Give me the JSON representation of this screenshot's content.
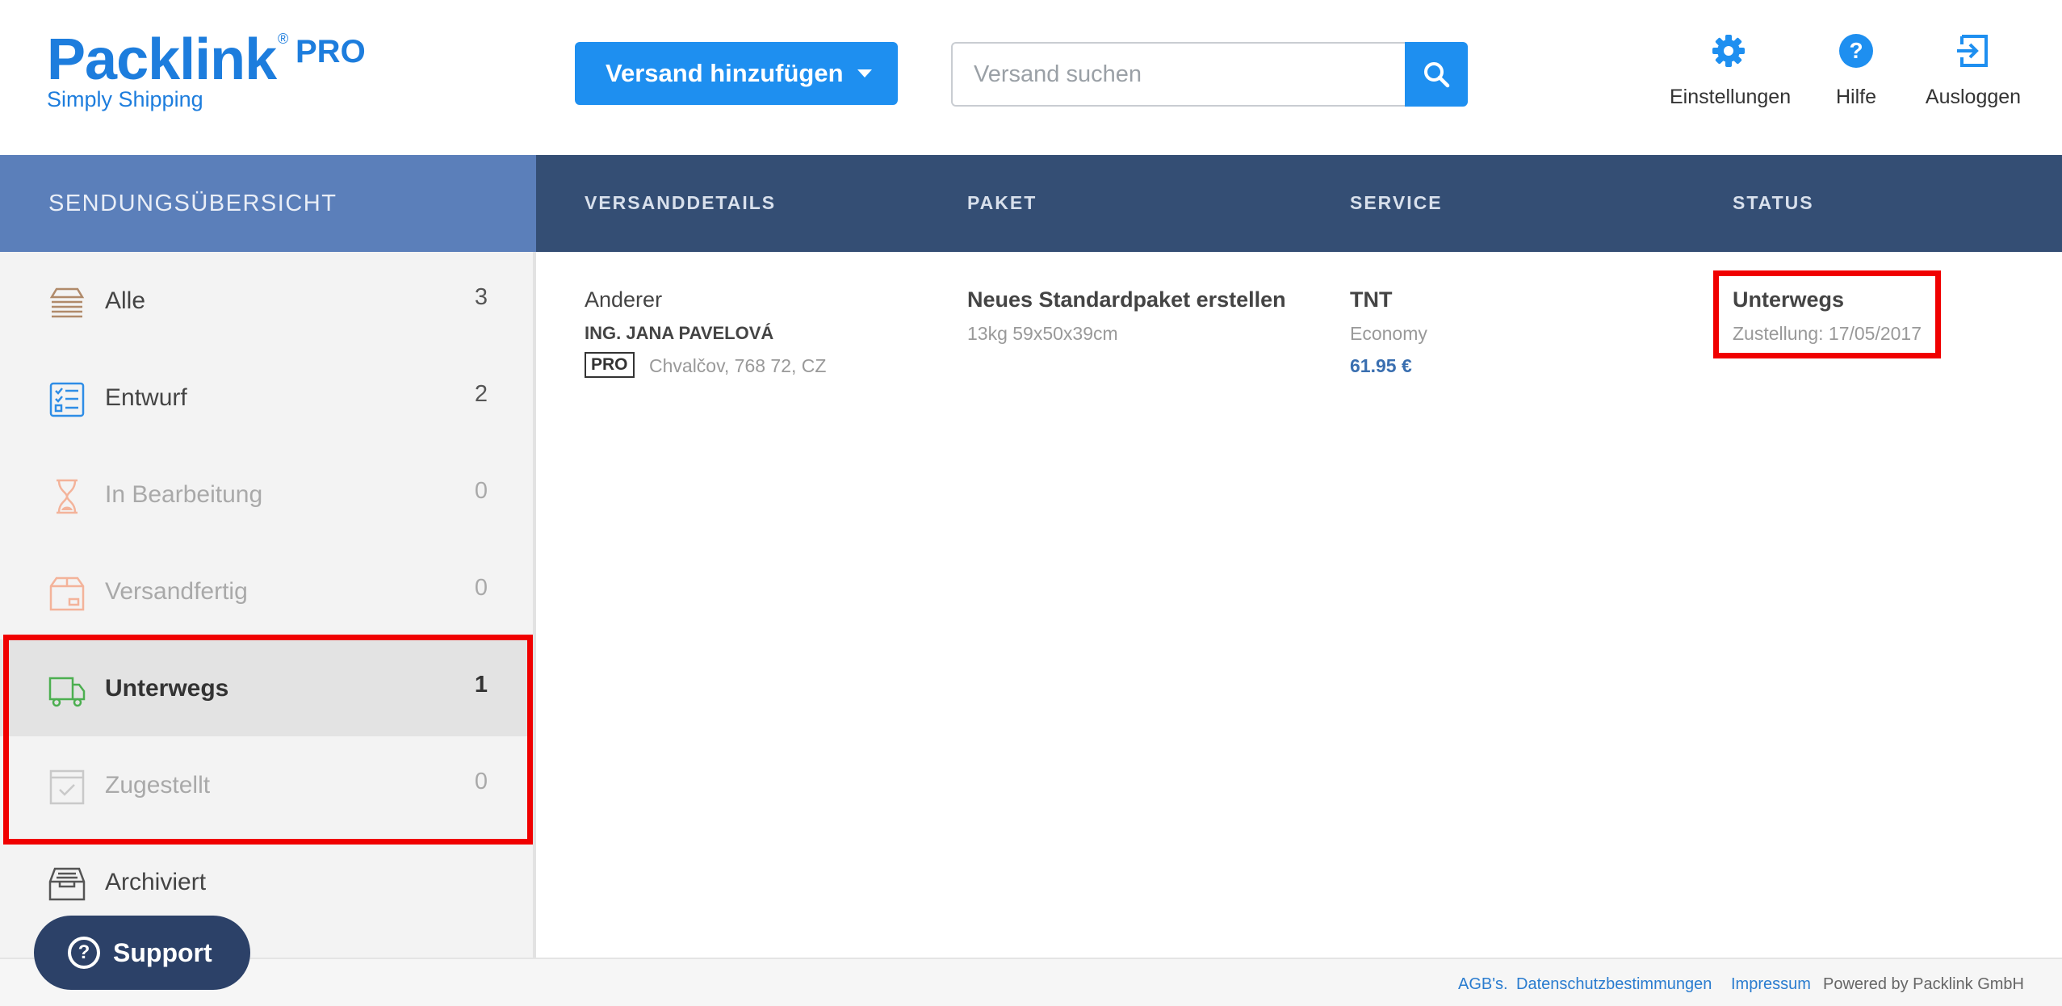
{
  "brand": {
    "name": "Packlink",
    "reg": "®",
    "tier": "PRO",
    "tagline": "Simply Shipping"
  },
  "header": {
    "add_button": "Versand hinzufügen",
    "search_placeholder": "Versand suchen",
    "links": [
      {
        "label": "Einstellungen",
        "icon": "gear-icon"
      },
      {
        "label": "Hilfe",
        "icon": "help-icon"
      },
      {
        "label": "Ausloggen",
        "icon": "logout-icon"
      }
    ]
  },
  "sidebar": {
    "title": "SENDUNGSÜBERSICHT",
    "items": [
      {
        "label": "Alle",
        "count": "3",
        "icon": "stack-icon"
      },
      {
        "label": "Entwurf",
        "count": "2",
        "icon": "checklist-icon"
      },
      {
        "label": "In Bearbeitung",
        "count": "0",
        "icon": "hourglass-icon"
      },
      {
        "label": "Versandfertig",
        "count": "0",
        "icon": "box-icon"
      },
      {
        "label": "Unterwegs",
        "count": "1",
        "icon": "truck-icon"
      },
      {
        "label": "Zugestellt",
        "count": "0",
        "icon": "delivered-icon"
      },
      {
        "label": "Archiviert",
        "count": "",
        "icon": "archive-icon"
      }
    ],
    "support_label": "Support"
  },
  "table": {
    "headers": [
      "VERSANDDETAILS",
      "PAKET",
      "SERVICE",
      "STATUS"
    ],
    "rows": [
      {
        "details": {
          "type": "Anderer",
          "name": "ING. JANA PAVELOVÁ",
          "badge": "PRO",
          "address": "Chvalčov, 768 72, CZ"
        },
        "package": {
          "title": "Neues Standardpaket erstellen",
          "spec": "13kg 59x50x39cm"
        },
        "service": {
          "carrier": "TNT",
          "level": "Economy",
          "price": "61.95 €"
        },
        "status": {
          "label": "Unterwegs",
          "delivery": "Zustellung: 17/05/2017"
        }
      }
    ]
  },
  "footer": {
    "links": [
      "AGB's.",
      "Datenschutzbestimmungen",
      "Impressum"
    ],
    "powered": "Powered by Packlink GmbH"
  },
  "colors": {
    "brand_blue": "#1d7ddd",
    "button_blue": "#1e8ff0",
    "sidebar_header": "#5b7fba",
    "table_header": "#344e74",
    "highlight_red": "#f00000",
    "in_transit_green": "#4caf50"
  }
}
